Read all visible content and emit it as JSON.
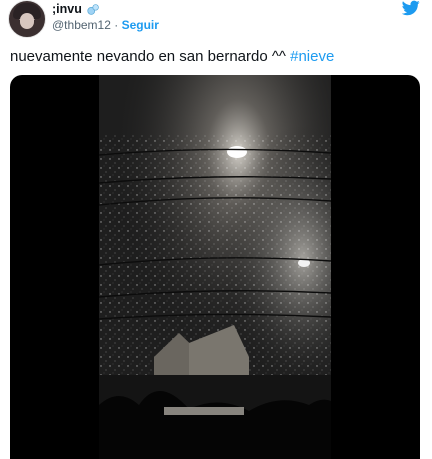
{
  "tweet": {
    "display_name": ";invu",
    "handle": "@thbem12",
    "separator": "·",
    "follow_label": "Seguir",
    "text": "nuevamente nevando en san bernardo ^^",
    "hashtag": "#nieve"
  },
  "icons": {
    "name_emoji": "snowflake-emoji-icon",
    "brand": "twitter-bird-icon"
  },
  "colors": {
    "accent": "#1d9bf0",
    "text": "#0f1419",
    "secondary": "#536471"
  }
}
